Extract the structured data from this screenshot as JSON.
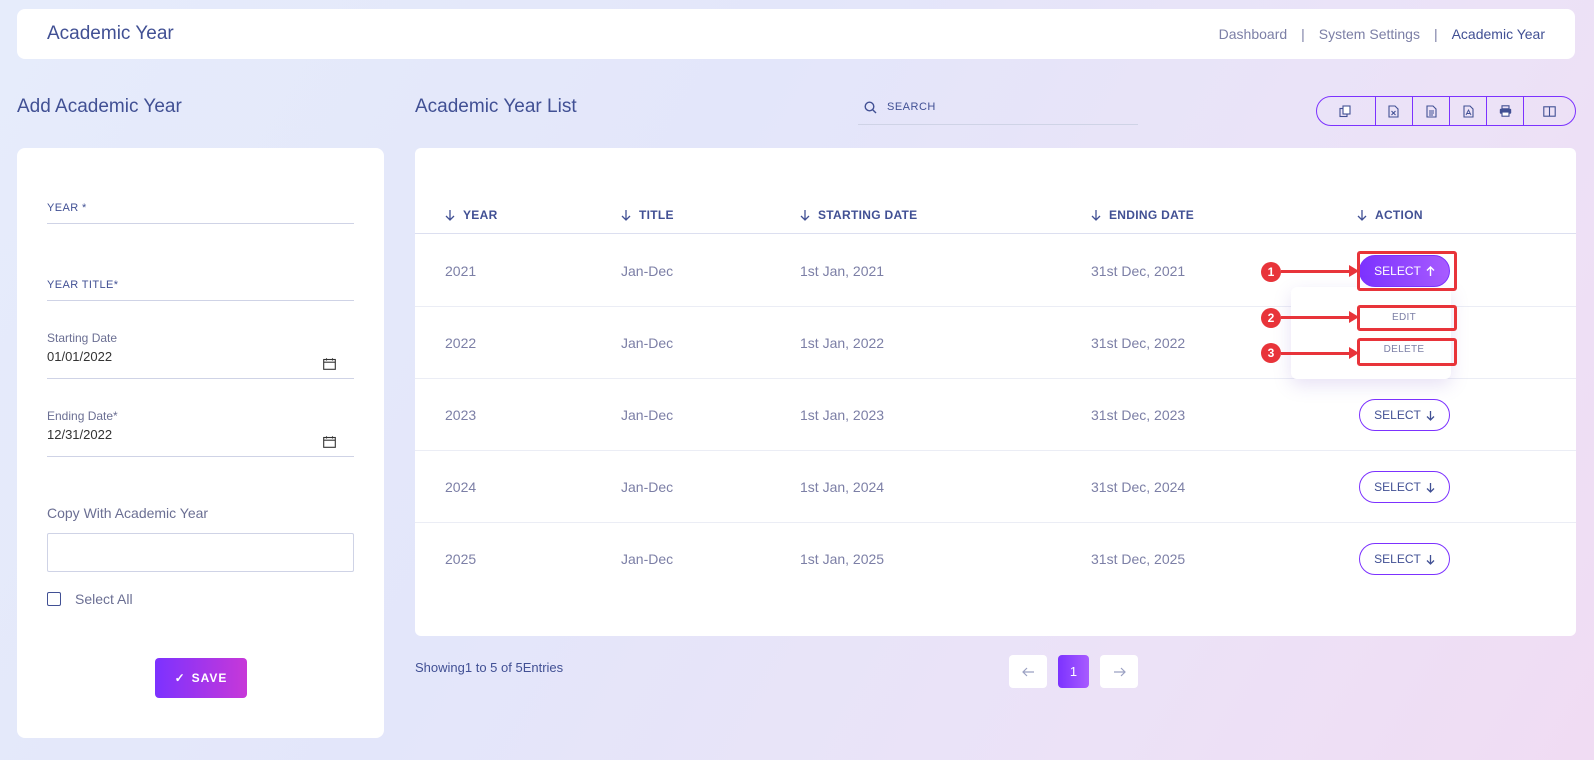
{
  "header": {
    "title": "Academic Year",
    "breadcrumb": [
      "Dashboard",
      "System Settings",
      "Academic Year"
    ]
  },
  "form": {
    "section_title": "Add Academic Year",
    "year_label": "YEAR *",
    "year_title_label": "YEAR TITLE*",
    "starting_date_label": "Starting Date",
    "starting_date_value": "01/01/2022",
    "ending_date_label": "Ending Date*",
    "ending_date_value": "12/31/2022",
    "copy_label": "Copy With Academic Year",
    "select_all_label": "Select All",
    "save_label": "SAVE"
  },
  "list": {
    "section_title": "Academic Year List",
    "search_placeholder": "SEARCH",
    "columns": [
      "YEAR",
      "TITLE",
      "STARTING DATE",
      "ENDING DATE",
      "ACTION"
    ],
    "rows": [
      {
        "year": "2021",
        "title": "Jan-Dec",
        "start": "1st Jan, 2021",
        "end": "31st Dec, 2021"
      },
      {
        "year": "2022",
        "title": "Jan-Dec",
        "start": "1st Jan, 2022",
        "end": "31st Dec, 2022"
      },
      {
        "year": "2023",
        "title": "Jan-Dec",
        "start": "1st Jan, 2023",
        "end": "31st Dec, 2023"
      },
      {
        "year": "2024",
        "title": "Jan-Dec",
        "start": "1st Jan, 2024",
        "end": "31st Dec, 2024"
      },
      {
        "year": "2025",
        "title": "Jan-Dec",
        "start": "1st Jan, 2025",
        "end": "31st Dec, 2025"
      }
    ],
    "select_label": "SELECT",
    "dropdown": {
      "edit": "EDIT",
      "delete": "DELETE"
    },
    "showing_text": "Showing1 to 5 of 5Entries",
    "current_page": "1"
  },
  "annotations": [
    "1",
    "2",
    "3"
  ],
  "colors": {
    "accent": "#7c32ff",
    "accent_end": "#c738d8",
    "highlight": "#e8343a",
    "text": "#415094"
  }
}
